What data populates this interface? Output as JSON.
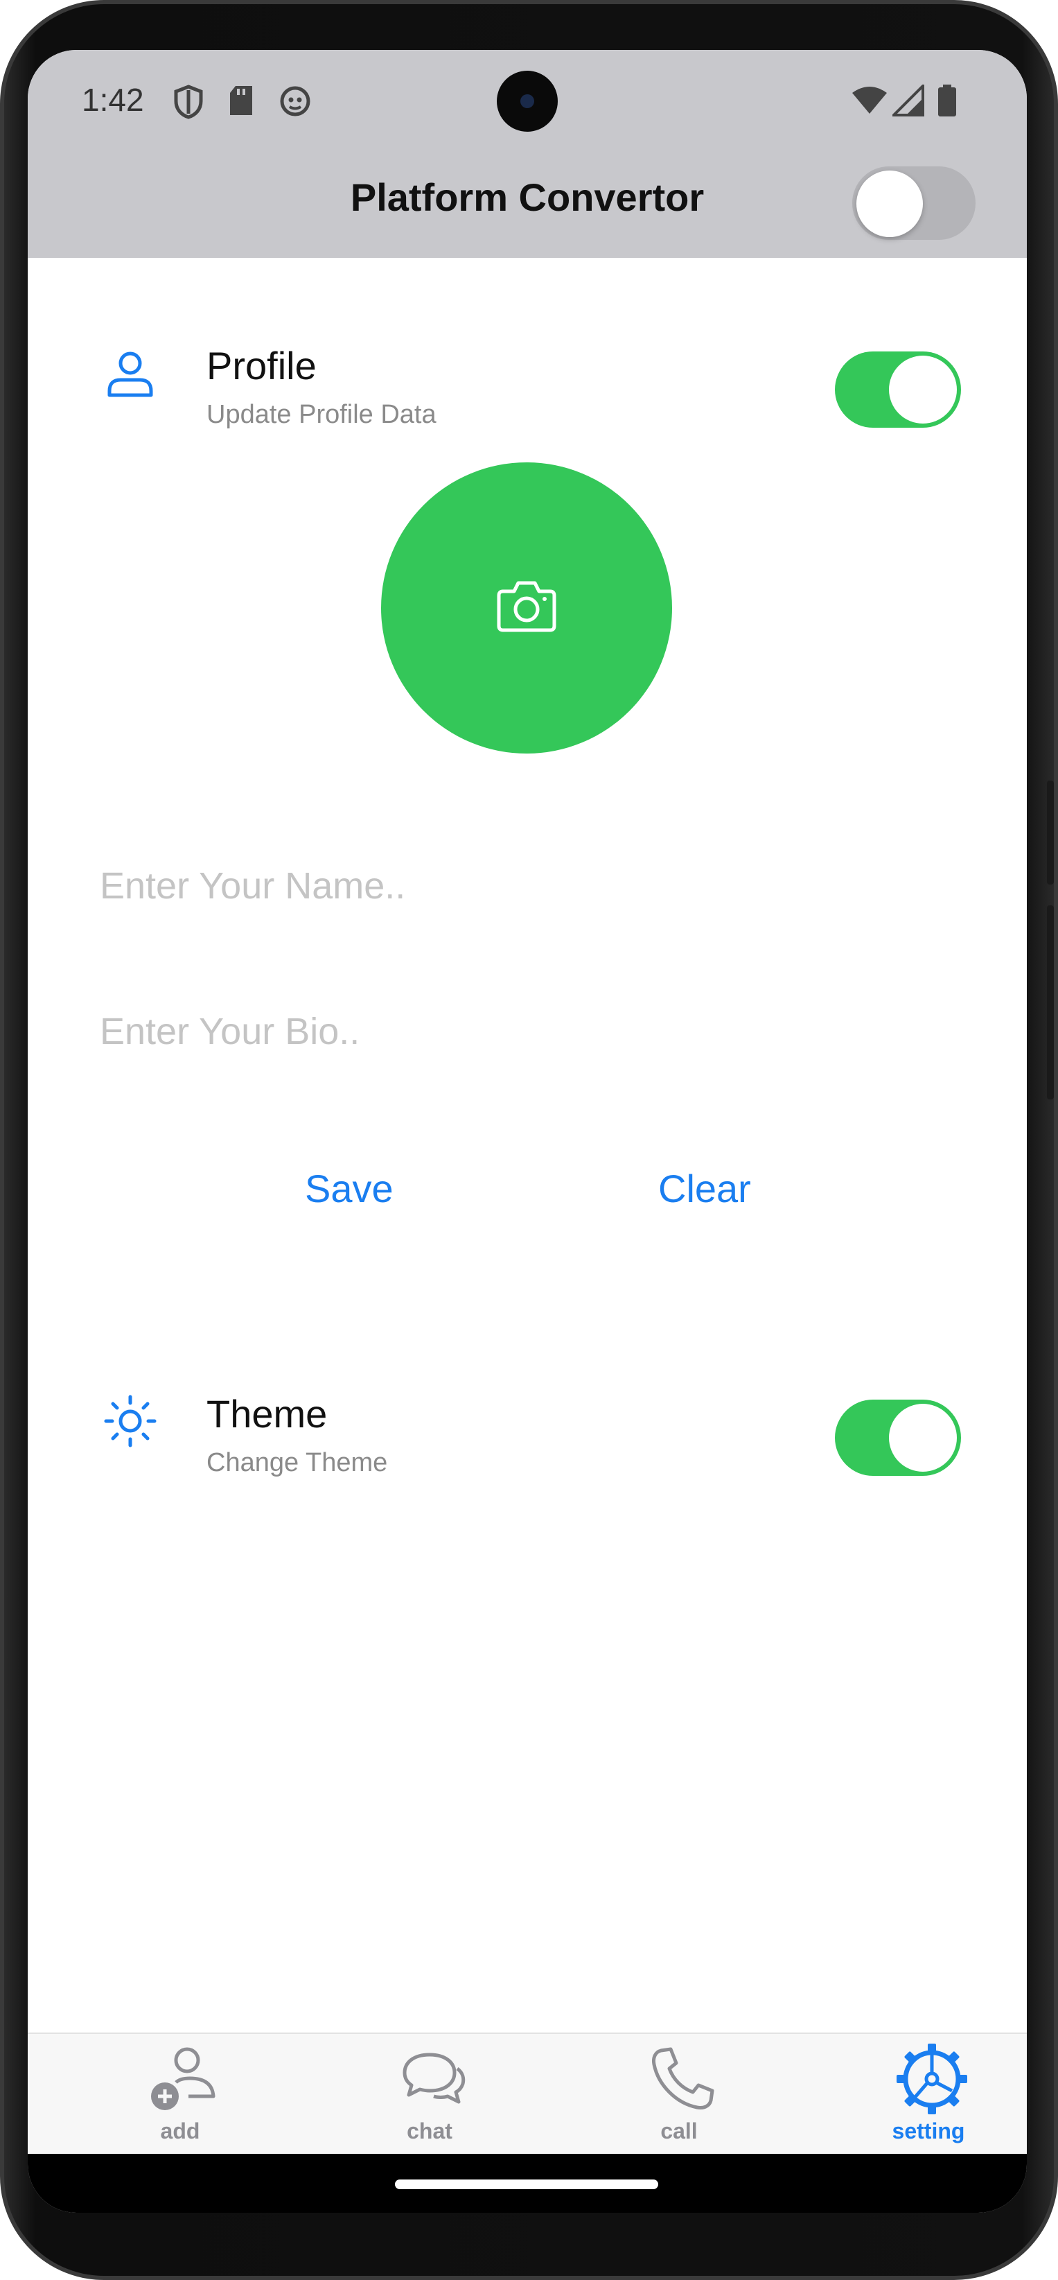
{
  "status_bar": {
    "time": "1:42"
  },
  "app_bar": {
    "title": "Platform Convertor",
    "platform_toggle_on": false
  },
  "profile_section": {
    "title": "Profile",
    "subtitle": "Update Profile Data",
    "toggle_on": true
  },
  "form": {
    "name_placeholder": "Enter Your Name..",
    "name_value": "",
    "bio_placeholder": "Enter Your Bio..",
    "bio_value": "",
    "save_label": "Save",
    "clear_label": "Clear"
  },
  "theme_section": {
    "title": "Theme",
    "subtitle": "Change Theme",
    "toggle_on": true
  },
  "tabs": [
    {
      "label": "add",
      "icon": "add-person-icon",
      "active": false
    },
    {
      "label": "chat",
      "icon": "chat-bubbles-icon",
      "active": false
    },
    {
      "label": "call",
      "icon": "phone-icon",
      "active": false
    },
    {
      "label": "setting",
      "icon": "gear-icon",
      "active": true
    }
  ],
  "colors": {
    "accent_blue": "#1a7ef0",
    "switch_green": "#34c759",
    "app_bar_gray": "#c8c8cc",
    "inactive_tab": "#8e8e93"
  }
}
